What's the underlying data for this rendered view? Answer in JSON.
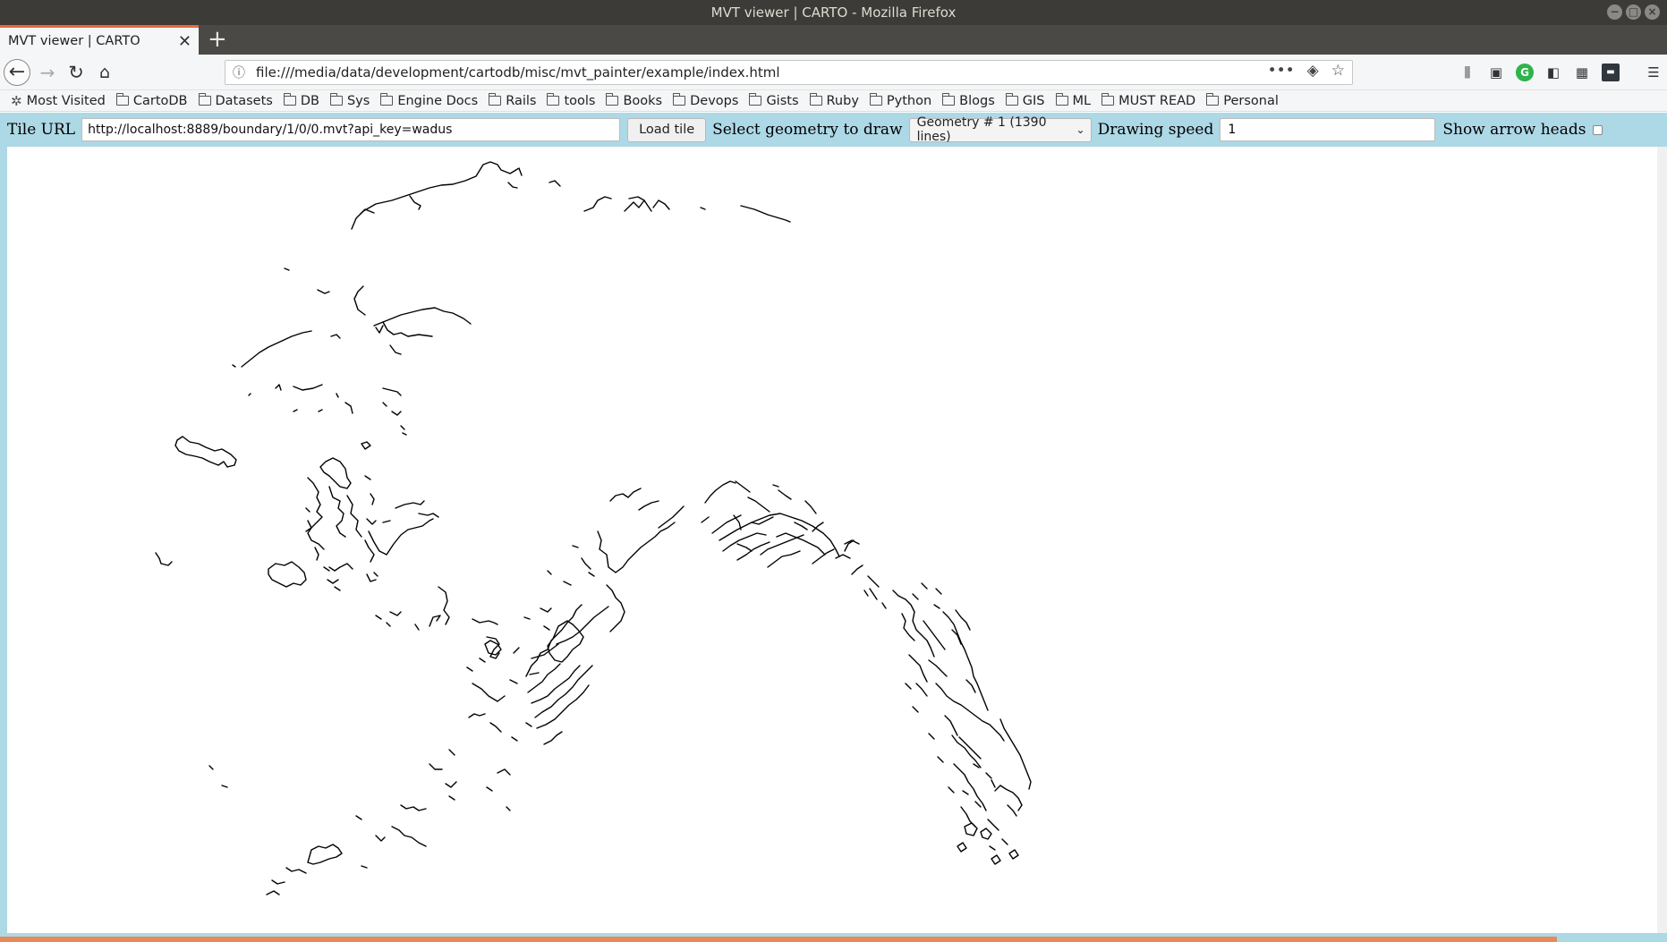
{
  "window": {
    "title": "MVT viewer | CARTO - Mozilla Firefox",
    "minimize": "−",
    "maximize": "□",
    "close": "×"
  },
  "tabs": [
    {
      "label": "MVT viewer | CARTO",
      "close": "✕"
    }
  ],
  "new_tab": "+",
  "nav": {
    "url": "file:///media/data/development/cartodb/misc/mvt_painter/example/index.html",
    "back_icon": "←",
    "forward_icon": "→",
    "reload_icon": "↻",
    "home_icon": "⌂",
    "info_icon": "ⓘ",
    "more_icon": "•••",
    "pocket_icon": "◈",
    "star_icon": "☆"
  },
  "bookmarks": [
    "Most Visited",
    "CartoDB",
    "Datasets",
    "DB",
    "Sys",
    "Engine Docs",
    "Rails",
    "tools",
    "Books",
    "Devops",
    "Gists",
    "Ruby",
    "Python",
    "Blogs",
    "GIS",
    "ML",
    "MUST READ",
    "Personal"
  ],
  "controls": {
    "tile_url_label": "Tile URL",
    "tile_url_value": "http://localhost:8889/boundary/1/0/0.mvt?api_key=wadus",
    "load_button": "Load tile",
    "select_label": "Select geometry to draw",
    "geometry_selected": "Geometry # 1 (1390 lines)",
    "speed_label": "Drawing speed",
    "speed_value": "1",
    "arrow_label": "Show arrow heads",
    "arrow_checked": false
  },
  "colors": {
    "accent": "#e66a3c",
    "page_bg": "#add8e6",
    "stroke": "#000000"
  },
  "icons": [
    "library-icon",
    "pocket-save-icon",
    "grammarly-icon",
    "sidebar-icon",
    "extensions-icon",
    "dark-extension-icon",
    "menu-icon"
  ]
}
